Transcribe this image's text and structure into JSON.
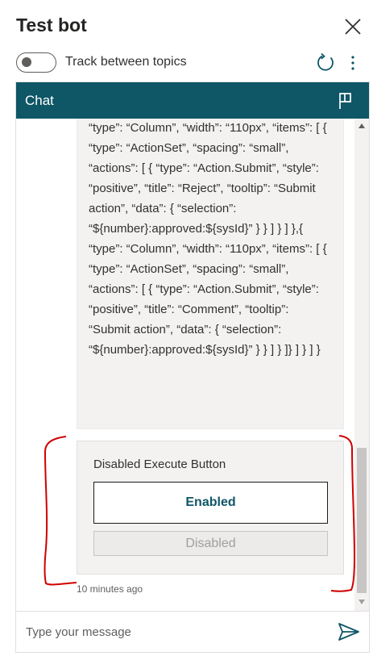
{
  "header": {
    "title": "Test bot",
    "close_icon": "close-icon"
  },
  "toggle": {
    "label": "Track between topics",
    "state": "off"
  },
  "toolbar": {
    "refresh_icon": "refresh-icon",
    "more_icon": "more-vertical-icon"
  },
  "chat": {
    "header_label": "Chat",
    "flag_icon": "flag-icon",
    "bot_message": "“type”: “Column”, “width”: “110px”, “items”: [ { “type”: “ActionSet”, “spacing”: “small”, “actions”: [ { “type”: “Action.Submit”, “style”: “positive”, “title”: “Reject”, “tooltip”: “Submit action”, “data”: { “selection”: “${number}:approved:${sysId}” } } ] } ] },{ “type”: “Column”, “width”: “110px”, “items”: [ { “type”: “ActionSet”, “spacing”: “small”, “actions”: [ { “type”: “Action.Submit”, “style”: “positive”, “title”: “Comment”, “tooltip”: “Submit action”, “data”: { “selection”: “${number}:approved:${sysId}” } } ] } ]} ] } ] }",
    "card": {
      "title": "Disabled Execute Button",
      "enabled_label": "Enabled",
      "disabled_label": "Disabled"
    },
    "timestamp": "10 minutes ago",
    "input": {
      "placeholder": "Type your message",
      "value": ""
    },
    "send_icon": "send-icon"
  },
  "colors": {
    "header_bg": "#0f5667",
    "annotation": "#d00000",
    "enabled_text": "#0f5667"
  }
}
